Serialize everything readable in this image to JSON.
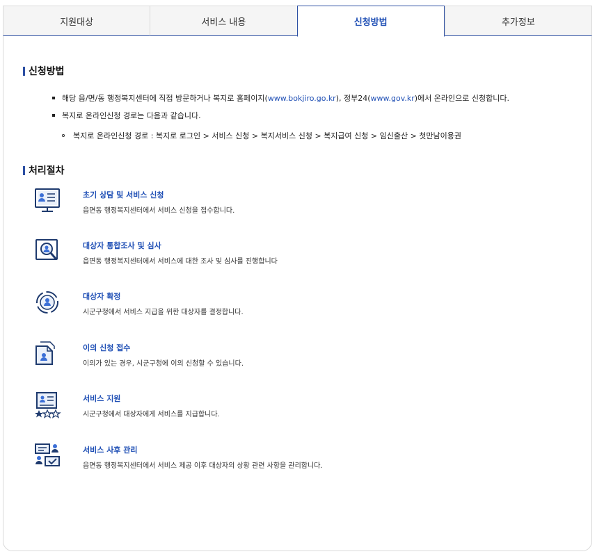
{
  "tabs": [
    {
      "label": "지원대상"
    },
    {
      "label": "서비스 내용"
    },
    {
      "label": "신청방법"
    },
    {
      "label": "추가정보"
    }
  ],
  "apply": {
    "title": "신청방법",
    "line1_pre": "해당 읍/면/동 행정복지센터에 직접 방문하거나 복지로 홈페이지(",
    "line1_link1": "www.bokjiro.go.kr",
    "line1_mid": "), 정부24(",
    "line1_link2": "www.gov.kr",
    "line1_post": ")에서 온라인으로 신청합니다.",
    "line2": "복지로 온라인신청 경로는 다음과 같습니다.",
    "line3": "복지로 온라인신청 경로 : 복지로 로그인 > 서비스 신청 > 복지서비스 신청 > 복지급여 신청 > 임신출산 > 첫만남이용권"
  },
  "process": {
    "title": "처리절차",
    "steps": [
      {
        "icon": "consultation-monitor-icon",
        "title": "초기 상담 및 서비스 신청",
        "desc": "읍면동 행정복지센터에서 서비스 신청을 접수합니다."
      },
      {
        "icon": "magnifier-person-icon",
        "title": "대상자 통합조사 및 심사",
        "desc": "읍면동 행정복지센터에서 서비스에 대한 조사 및 심사를 진행합니다"
      },
      {
        "icon": "target-person-icon",
        "title": "대상자 확정",
        "desc": "시군구청에서 서비스 지급을 위한 대상자를 결정합니다."
      },
      {
        "icon": "document-person-icon",
        "title": "이의 신청 접수",
        "desc": "이의가 있는 경우, 시군구청에 이의 신청할 수 있습니다."
      },
      {
        "icon": "id-card-stars-icon",
        "title": "서비스 지원",
        "desc": "시군구청에서 대상자에게 서비스를 지급합니다."
      },
      {
        "icon": "management-check-icon",
        "title": "서비스 사후 관리",
        "desc": "읍면동 행정복지센터에서 서비스 제공 이후 대상자의 상황 관련 사항을 관리합니다."
      }
    ]
  },
  "colors": {
    "accent": "#1f4fb5",
    "tab_border": "#2c4fa3",
    "icon": "#1e3a6e"
  }
}
